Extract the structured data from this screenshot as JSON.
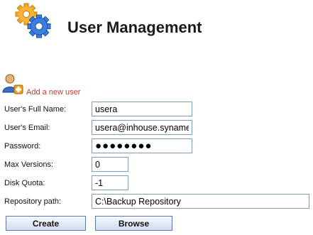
{
  "header": {
    "title": "User Management",
    "icon": "gears-icon"
  },
  "add_user": {
    "label": "Add a new user",
    "icon": "user-add-icon"
  },
  "form": {
    "full_name": {
      "label": "User's Full Name:",
      "value": "usera"
    },
    "email": {
      "label": "User's Email:",
      "value": "usera@inhouse.synametrics.com"
    },
    "password": {
      "label": "Password:",
      "value": "●●●●●●●●"
    },
    "max_versions": {
      "label": "Max Versions:",
      "value": "0"
    },
    "disk_quota": {
      "label": "Disk Quota:",
      "value": "-1"
    },
    "repository_path": {
      "label": "Repository path:",
      "value": "C:\\Backup Repository"
    }
  },
  "buttons": {
    "create": "Create",
    "browse": "Browse"
  },
  "colors": {
    "link": "#c0392b",
    "field_border": "#7f9db9",
    "button_border": "#5a78a8"
  }
}
